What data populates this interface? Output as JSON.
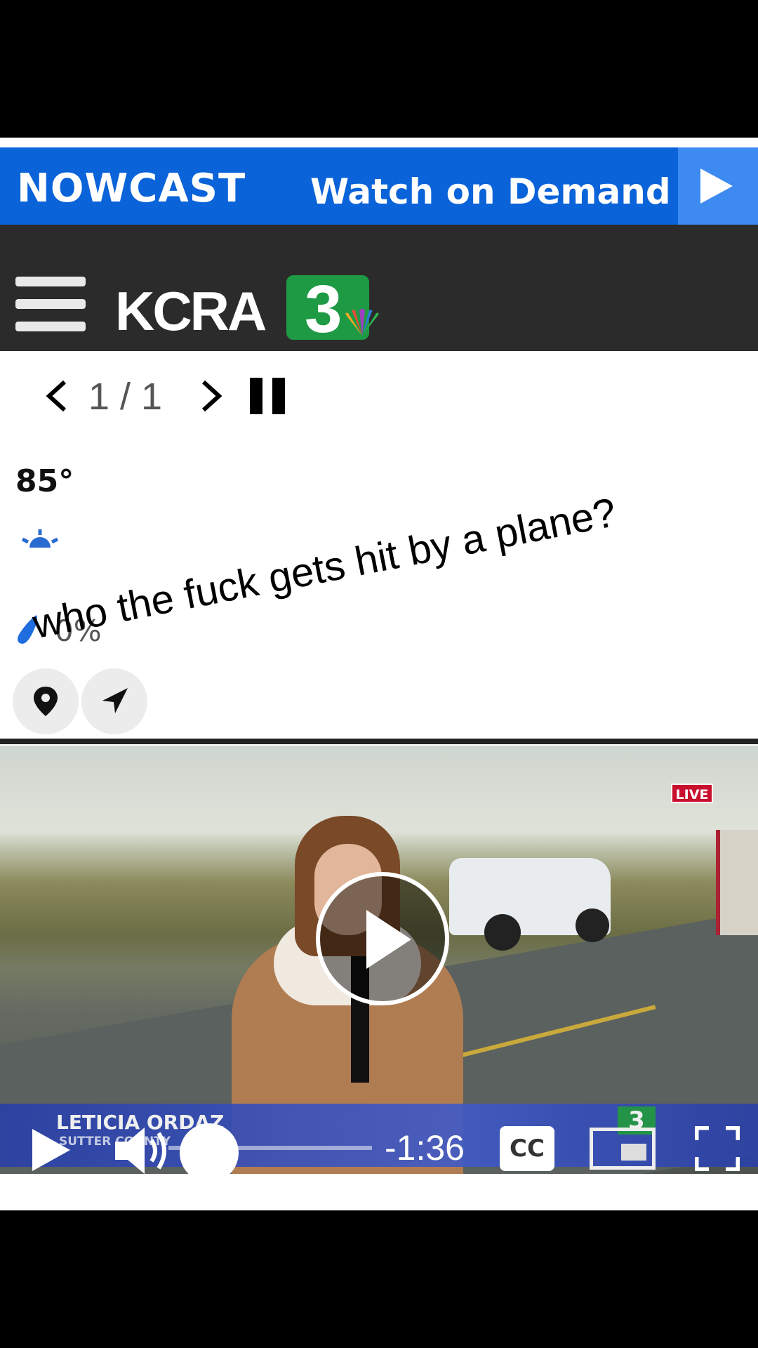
{
  "banner": {
    "brand": "NOWCAST",
    "cta": "Watch on Demand",
    "play_icon": "play-icon"
  },
  "header": {
    "menu_icon": "hamburger-menu-icon",
    "logo_text": "KCRA",
    "logo_number": "3"
  },
  "pager": {
    "text": "1 / 1"
  },
  "weather": {
    "temperature": "85°",
    "condition_icon": "sun-icon",
    "rain_chance": "0%"
  },
  "caption": "who the fuck gets hit by a plane?",
  "video": {
    "live_label": "LIVE",
    "reporter_name": "LETICIA ORDAZ",
    "reporter_location": "SUTTER COUNTY",
    "corner_logo": "3",
    "time_remaining": "-1:36",
    "cc_label": "CC",
    "progress": 0.05
  },
  "colors": {
    "banner_blue": "#0a63d8",
    "header_dark": "#2b2b2b",
    "brand_green": "#1e9a45",
    "live_red": "#c8102e"
  }
}
